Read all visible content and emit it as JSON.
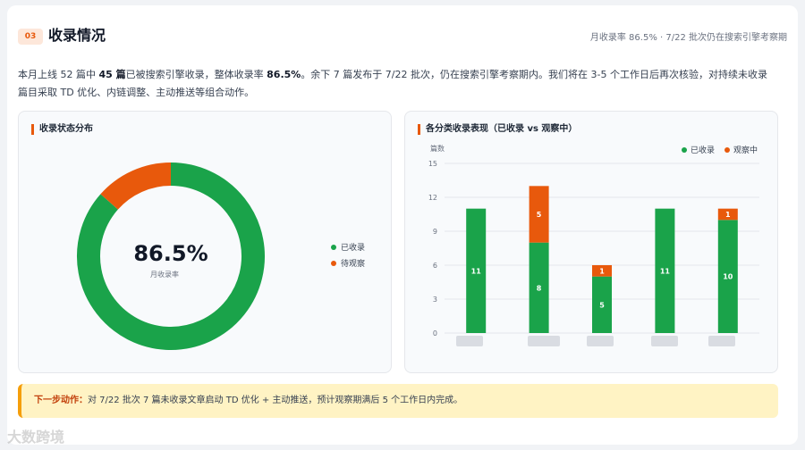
{
  "section": {
    "badge": "03",
    "title": "收录情况",
    "subtitle": "月收录率 86.5% · 7/22 批次仍在搜索引擎考察期"
  },
  "summary": {
    "p1": "本月上线 52 篇中 ",
    "b1": "45 篇",
    "p2": "已被搜索引擎收录，整体收录率 ",
    "b2": "86.5%",
    "p3": "。余下 7 篇发布于 7/22 批次，仍在搜索引擎考察期内。我们将在 3-5 个工作日后再次核验，对持续未收录篇目采取 TD 优化、内链调整、主动推送等组合动作。"
  },
  "colors": {
    "indexed": "#1aa34a",
    "observing": "#e8590c"
  },
  "chart_data": [
    {
      "type": "pie",
      "title": "收录状态分布",
      "center_value": "86.5%",
      "center_label": "月收录率",
      "slices": [
        {
          "name": "已收录",
          "value": 45
        },
        {
          "name": "待观察",
          "value": 7
        }
      ]
    },
    {
      "type": "bar",
      "stacked": true,
      "title": "各分类收录表现（已收录 vs 观察中）",
      "ylabel": "篇数",
      "ylim": [
        0,
        15
      ],
      "yticks": [
        0,
        3,
        6,
        9,
        12,
        15
      ],
      "categories": [
        "",
        "",
        "",
        "",
        ""
      ],
      "series": [
        {
          "name": "已收录",
          "values": [
            11,
            8,
            5,
            11,
            10
          ]
        },
        {
          "name": "观察中",
          "values": [
            0,
            5,
            1,
            0,
            1
          ]
        }
      ],
      "legend": "top-right"
    }
  ],
  "action": {
    "label": "下一步动作：",
    "text": "对 7/22 批次 7 篇未收录文章启动 TD 优化 + 主动推送，预计观察期满后 5 个工作日内完成。"
  },
  "watermark": "大数跨境"
}
